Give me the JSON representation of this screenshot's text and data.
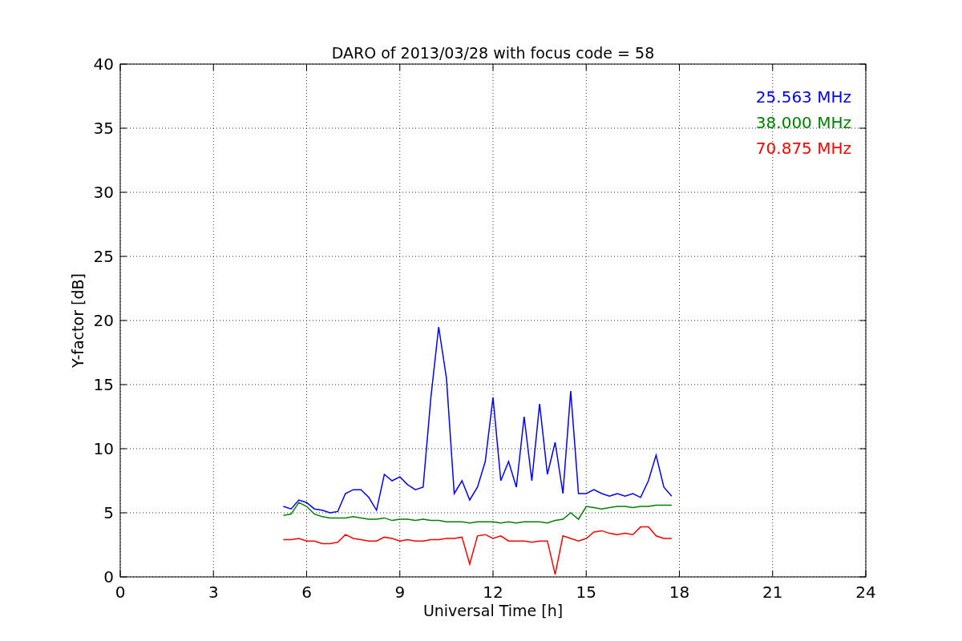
{
  "chart_data": {
    "type": "line",
    "grid": true,
    "title": "DARO of 2013/03/28 with focus code = 58",
    "xlabel": "Universal Time [h]",
    "ylabel": "Y-factor [dB]",
    "xlim": [
      0,
      24
    ],
    "ylim": [
      0,
      40
    ],
    "xticks": [
      0,
      3,
      6,
      9,
      12,
      15,
      18,
      21,
      24
    ],
    "yticks": [
      0,
      5,
      10,
      15,
      20,
      25,
      30,
      35,
      40
    ],
    "x": [
      5.25,
      5.5,
      5.75,
      6,
      6.25,
      6.5,
      6.75,
      7,
      7.25,
      7.5,
      7.75,
      8,
      8.25,
      8.5,
      8.75,
      9,
      9.25,
      9.5,
      9.75,
      10,
      10.25,
      10.5,
      10.75,
      11,
      11.25,
      11.5,
      11.75,
      12,
      12.25,
      12.5,
      12.75,
      13,
      13.25,
      13.5,
      13.75,
      14,
      14.25,
      14.5,
      14.75,
      15,
      15.25,
      15.5,
      15.75,
      16,
      16.25,
      16.5,
      16.75,
      17,
      17.25,
      17.5,
      17.75
    ],
    "series": [
      {
        "name": "25.563 MHz",
        "color": "#0000ff",
        "values": [
          5.5,
          5.3,
          6.0,
          5.8,
          5.3,
          5.2,
          5.0,
          5.1,
          6.5,
          6.8,
          6.8,
          6.2,
          5.2,
          8.0,
          7.5,
          7.8,
          7.2,
          6.8,
          7.0,
          14,
          19.5,
          15.5,
          6.5,
          7.5,
          6.0,
          7.0,
          9.0,
          14.0,
          7.5,
          9.0,
          7.0,
          12.5,
          7.5,
          13.5,
          8.0,
          10.5,
          6.5,
          14.5,
          6.5,
          6.5,
          6.8,
          6.5,
          6.3,
          6.5,
          6.3,
          6.5,
          6.2,
          7.5,
          9.5,
          7.0,
          6.3
        ]
      },
      {
        "name": "38.000 MHz",
        "color": "#008000",
        "values": [
          4.8,
          4.9,
          5.8,
          5.5,
          4.9,
          4.7,
          4.6,
          4.6,
          4.6,
          4.7,
          4.6,
          4.5,
          4.5,
          4.6,
          4.4,
          4.5,
          4.5,
          4.4,
          4.5,
          4.4,
          4.4,
          4.3,
          4.3,
          4.3,
          4.2,
          4.3,
          4.3,
          4.3,
          4.2,
          4.3,
          4.2,
          4.3,
          4.3,
          4.3,
          4.2,
          4.4,
          4.5,
          5.0,
          4.5,
          5.5,
          5.4,
          5.3,
          5.4,
          5.5,
          5.5,
          5.4,
          5.5,
          5.5,
          5.6,
          5.6,
          5.6
        ]
      },
      {
        "name": "70.875 MHz",
        "color": "#ff0000",
        "values": [
          2.9,
          2.9,
          3.0,
          2.8,
          2.8,
          2.6,
          2.6,
          2.7,
          3.3,
          3.0,
          2.9,
          2.8,
          2.8,
          3.1,
          3.0,
          2.8,
          2.9,
          2.8,
          2.8,
          2.9,
          2.9,
          3.0,
          3.0,
          3.1,
          1.0,
          3.2,
          3.3,
          3.0,
          3.2,
          2.8,
          2.8,
          2.8,
          2.7,
          2.8,
          2.8,
          0.2,
          3.2,
          3.0,
          2.8,
          3.0,
          3.5,
          3.6,
          3.4,
          3.3,
          3.4,
          3.3,
          3.9,
          3.9,
          3.2,
          3.0,
          3.0
        ]
      }
    ]
  }
}
